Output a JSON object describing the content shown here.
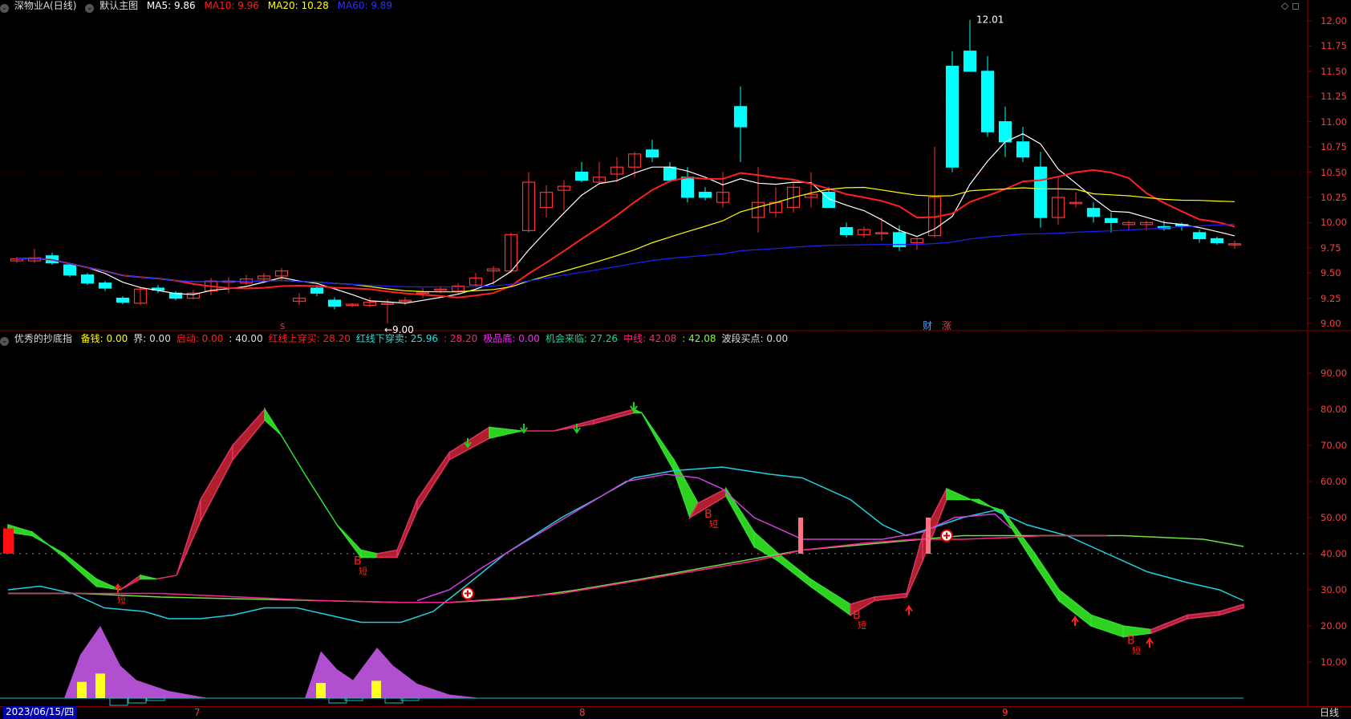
{
  "price_header": {
    "stock": "深物业A(日线)",
    "template": "默认主图",
    "ma5": "MA5: 9.86",
    "ma10": "MA10: 9.96",
    "ma20": "MA20: 10.28",
    "ma60": "MA60: 9.89"
  },
  "indicator_header": {
    "name": "优秀的抄底指",
    "items": [
      {
        "label": "备钱: 0.00",
        "color": "#ffff00"
      },
      {
        "label": "界: 0.00",
        "color": "#dddddd"
      },
      {
        "label": "启动: 0.00",
        "color": "#ff2020"
      },
      {
        "label": ": 40.00",
        "color": "#dddddd"
      },
      {
        "label": "红线上穿买: 28.20",
        "color": "#ff2020"
      },
      {
        "label": "红线下穿卖: 25.96",
        "color": "#20e0e0"
      },
      {
        "label": ": 28.20",
        "color": "#ff2080"
      },
      {
        "label": "极品底: 0.00",
        "color": "#ff20ff"
      },
      {
        "label": "机会来临: 27.26",
        "color": "#20d0a0"
      },
      {
        "label": "中线: 42.08",
        "color": "#ff2080"
      },
      {
        "label": ": 42.08",
        "color": "#80ff40"
      },
      {
        "label": "波段买点: 0.00",
        "color": "#dddddd"
      }
    ]
  },
  "price_axis": [
    "12.00",
    "11.75",
    "11.50",
    "11.25",
    "11.00",
    "10.75",
    "10.50",
    "10.25",
    "10.00",
    "9.75",
    "9.50",
    "9.25",
    "9.00"
  ],
  "indicator_axis": [
    "90.00",
    "80.00",
    "70.00",
    "60.00",
    "50.00",
    "40.00",
    "30.00",
    "20.00",
    "10.00"
  ],
  "annotations": {
    "high_label": "12.01",
    "low_label": "←9.00",
    "event_cai": "财",
    "event_zhang": "涨",
    "event_s": "s",
    "b_marker": "B",
    "short_marker": "短"
  },
  "date_badge": "2023/06/15/四",
  "months": [
    "7",
    "8",
    "9"
  ],
  "period": "日线",
  "colors": {
    "up": "#ff3030",
    "down": "#00ffff",
    "ma5": "#ffffff",
    "ma10": "#ff2020",
    "ma20": "#ffff00",
    "ma60": "#2020ff",
    "axis": "#8b0000"
  },
  "chart_data": {
    "type": "candlestick",
    "ohlc": [
      [
        9.62,
        9.66,
        9.6,
        9.64
      ],
      [
        9.62,
        9.74,
        9.6,
        9.65
      ],
      [
        9.67,
        9.7,
        9.58,
        9.6
      ],
      [
        9.58,
        9.6,
        9.46,
        9.48
      ],
      [
        9.48,
        9.5,
        9.38,
        9.4
      ],
      [
        9.4,
        9.42,
        9.32,
        9.35
      ],
      [
        9.25,
        9.27,
        9.19,
        9.21
      ],
      [
        9.2,
        9.36,
        9.18,
        9.34
      ],
      [
        9.35,
        9.38,
        9.3,
        9.33
      ],
      [
        9.3,
        9.32,
        9.23,
        9.25
      ],
      [
        9.25,
        9.33,
        9.24,
        9.3
      ],
      [
        9.32,
        9.45,
        9.28,
        9.42
      ],
      [
        9.42,
        9.46,
        9.3,
        9.42
      ],
      [
        9.4,
        9.48,
        9.38,
        9.44
      ],
      [
        9.44,
        9.5,
        9.4,
        9.47
      ],
      [
        9.47,
        9.55,
        9.42,
        9.52
      ],
      [
        9.22,
        9.3,
        9.18,
        9.25
      ],
      [
        9.35,
        9.38,
        9.27,
        9.3
      ],
      [
        9.23,
        9.26,
        9.14,
        9.17
      ],
      [
        9.18,
        9.2,
        9.16,
        9.19
      ],
      [
        9.18,
        9.26,
        9.16,
        9.21
      ],
      [
        9.2,
        9.24,
        9.0,
        9.2
      ],
      [
        9.22,
        9.26,
        9.18,
        9.23
      ],
      [
        9.3,
        9.35,
        9.25,
        9.31
      ],
      [
        9.33,
        9.37,
        9.3,
        9.34
      ],
      [
        9.32,
        9.4,
        9.29,
        9.37
      ],
      [
        9.38,
        9.5,
        9.36,
        9.45
      ],
      [
        9.52,
        9.57,
        9.38,
        9.54
      ],
      [
        9.52,
        9.9,
        9.5,
        9.88
      ],
      [
        9.92,
        10.5,
        9.9,
        10.4
      ],
      [
        10.15,
        10.37,
        10.05,
        10.3
      ],
      [
        10.32,
        10.42,
        10.12,
        10.36
      ],
      [
        10.5,
        10.6,
        10.4,
        10.42
      ],
      [
        10.4,
        10.6,
        10.38,
        10.45
      ],
      [
        10.48,
        10.65,
        10.4,
        10.55
      ],
      [
        10.55,
        10.7,
        10.45,
        10.68
      ],
      [
        10.72,
        10.82,
        10.6,
        10.65
      ],
      [
        10.55,
        10.6,
        10.4,
        10.42
      ],
      [
        10.45,
        10.55,
        10.2,
        10.25
      ],
      [
        10.3,
        10.35,
        10.22,
        10.25
      ],
      [
        10.2,
        10.5,
        10.15,
        10.3
      ],
      [
        11.15,
        11.35,
        10.6,
        10.95
      ],
      [
        10.05,
        10.55,
        9.9,
        10.2
      ],
      [
        10.1,
        10.35,
        10.05,
        10.2
      ],
      [
        10.15,
        10.4,
        10.1,
        10.35
      ],
      [
        10.25,
        10.5,
        10.15,
        10.28
      ],
      [
        10.3,
        10.35,
        10.2,
        10.15
      ],
      [
        9.95,
        10.0,
        9.85,
        9.88
      ],
      [
        9.88,
        9.96,
        9.85,
        9.93
      ],
      [
        9.9,
        10.05,
        9.82,
        9.9
      ],
      [
        9.9,
        9.97,
        9.72,
        9.76
      ],
      [
        9.8,
        9.85,
        9.73,
        9.84
      ],
      [
        9.87,
        10.75,
        9.85,
        10.25
      ],
      [
        11.55,
        11.7,
        10.5,
        10.55
      ],
      [
        11.7,
        12.01,
        11.5,
        11.5
      ],
      [
        11.5,
        11.65,
        10.85,
        10.9
      ],
      [
        11.0,
        11.15,
        10.65,
        10.8
      ],
      [
        10.8,
        10.95,
        10.6,
        10.65
      ],
      [
        10.55,
        10.7,
        9.95,
        10.05
      ],
      [
        10.05,
        10.45,
        9.98,
        10.25
      ],
      [
        10.2,
        10.3,
        10.15,
        10.2
      ],
      [
        10.14,
        10.2,
        10.0,
        10.06
      ],
      [
        10.04,
        10.1,
        9.9,
        10.0
      ],
      [
        9.98,
        10.02,
        9.92,
        10.0
      ],
      [
        9.98,
        10.02,
        9.92,
        10.0
      ],
      [
        9.96,
        10.02,
        9.92,
        9.94
      ],
      [
        9.98,
        10.0,
        9.92,
        9.97
      ],
      [
        9.9,
        9.93,
        9.8,
        9.84
      ],
      [
        9.84,
        9.86,
        9.78,
        9.8
      ],
      [
        9.78,
        9.82,
        9.74,
        9.79
      ]
    ],
    "ma_last": {
      "MA5": 9.86,
      "MA10": 9.96,
      "MA20": 10.28,
      "MA60": 9.89
    },
    "ylim": [
      8.95,
      12.05
    ]
  }
}
